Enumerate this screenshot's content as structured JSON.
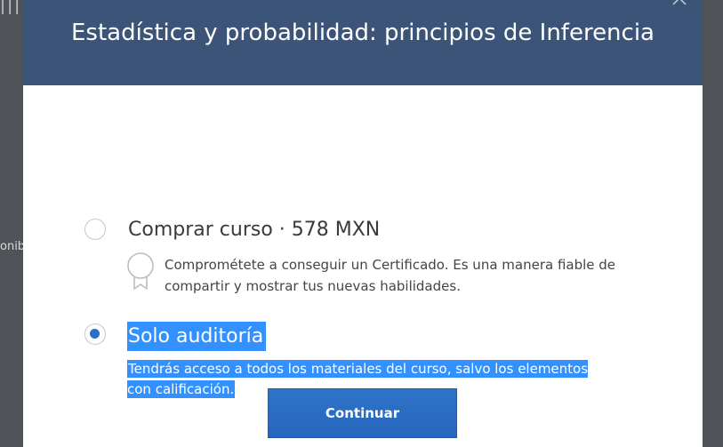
{
  "backdrop": {
    "left_partial_text": "onib"
  },
  "modal": {
    "title": "Estadística y probabilidad: principios de Inferencia",
    "close_icon": "close-icon"
  },
  "options": {
    "purchase": {
      "title": "Comprar curso · 578 MXN",
      "description": "Comprométete a conseguir un Certificado. Es una manera fiable de compartir y mostrar tus nuevas habilidades.",
      "selected": false,
      "icon": "certificate-ribbon-icon"
    },
    "audit": {
      "title": "Solo auditoría",
      "description": "Tendrás acceso a todos los materiales del curso, salvo los elementos con calificación.",
      "selected": true
    }
  },
  "actions": {
    "continue_label": "Continuar"
  },
  "colors": {
    "header_bg": "#3b5478",
    "primary_button": "#2a6cc2",
    "selection_highlight": "#3390ff",
    "radio_checked": "#2e6cc7"
  }
}
